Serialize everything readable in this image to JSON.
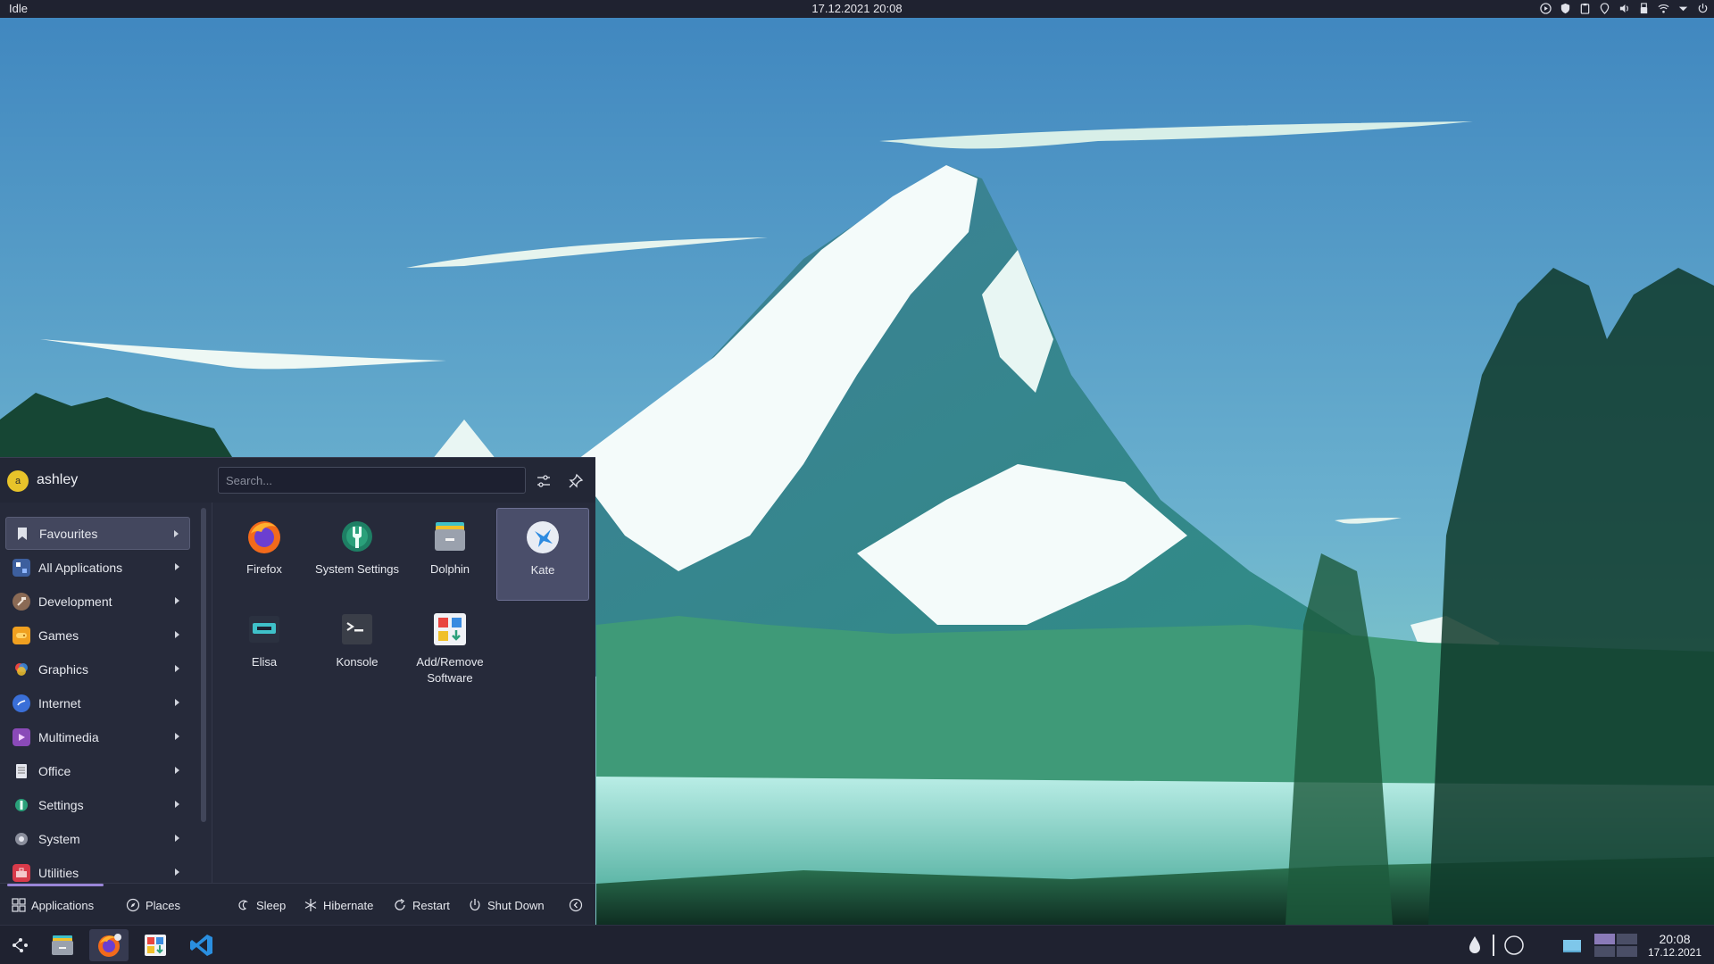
{
  "top_bar": {
    "status": "Idle",
    "datetime": "17.12.2021  20:08",
    "tray_icons": [
      "media-play-icon",
      "shield-icon",
      "clipboard-icon",
      "location-icon",
      "volume-icon",
      "usb-icon",
      "wifi-icon",
      "expand-arrow-icon",
      "power-icon"
    ]
  },
  "launcher": {
    "user": {
      "avatar_letter": "a",
      "name": "ashley"
    },
    "search": {
      "placeholder": "Search...",
      "value": ""
    },
    "categories": [
      {
        "label": "Favourites",
        "icon": "bookmark-icon",
        "color": "#cfd3e0",
        "active": true
      },
      {
        "label": "All Applications",
        "icon": "grid-icon",
        "color": "#4a6fb0"
      },
      {
        "label": "Development",
        "icon": "hammer-icon",
        "color": "#8a6a55"
      },
      {
        "label": "Games",
        "icon": "gamepad-icon",
        "color": "#f0a020"
      },
      {
        "label": "Graphics",
        "icon": "palette-icon",
        "color": "#d84b8a"
      },
      {
        "label": "Internet",
        "icon": "globe-icon",
        "color": "#3a6fd8"
      },
      {
        "label": "Multimedia",
        "icon": "media-icon",
        "color": "#8a4ab8"
      },
      {
        "label": "Office",
        "icon": "document-icon",
        "color": "#d8dbe4"
      },
      {
        "label": "Settings",
        "icon": "settings-icon",
        "color": "#2aa07a"
      },
      {
        "label": "System",
        "icon": "system-icon",
        "color": "#8a8e9c"
      },
      {
        "label": "Utilities",
        "icon": "toolbox-icon",
        "color": "#d83a4a"
      }
    ],
    "apps": [
      {
        "label": "Firefox",
        "icon": "firefox-icon"
      },
      {
        "label": "System Settings",
        "icon": "system-settings-icon"
      },
      {
        "label": "Dolphin",
        "icon": "dolphin-icon"
      },
      {
        "label": "Kate",
        "icon": "kate-icon",
        "selected": true
      },
      {
        "label": "Elisa",
        "icon": "elisa-icon"
      },
      {
        "label": "Konsole",
        "icon": "konsole-icon"
      },
      {
        "label": "Add/Remove Software",
        "icon": "discover-icon"
      }
    ],
    "footer": {
      "tabs": [
        "Applications",
        "Places"
      ],
      "actions": [
        "Sleep",
        "Hibernate",
        "Restart",
        "Shut Down"
      ]
    }
  },
  "taskbar": {
    "items": [
      "app-launcher-icon",
      "dolphin-icon",
      "firefox-icon",
      "discover-icon",
      "vscode-icon"
    ],
    "tray": [
      "color-picker-icon",
      "night-mode-icon",
      "show-desktop-icon"
    ],
    "clock": {
      "time": "20:08",
      "date": "17.12.2021"
    }
  },
  "colors": {
    "panel": "#1f2230",
    "launcher_bg": "#262a3a",
    "accent": "#9a86d8"
  }
}
